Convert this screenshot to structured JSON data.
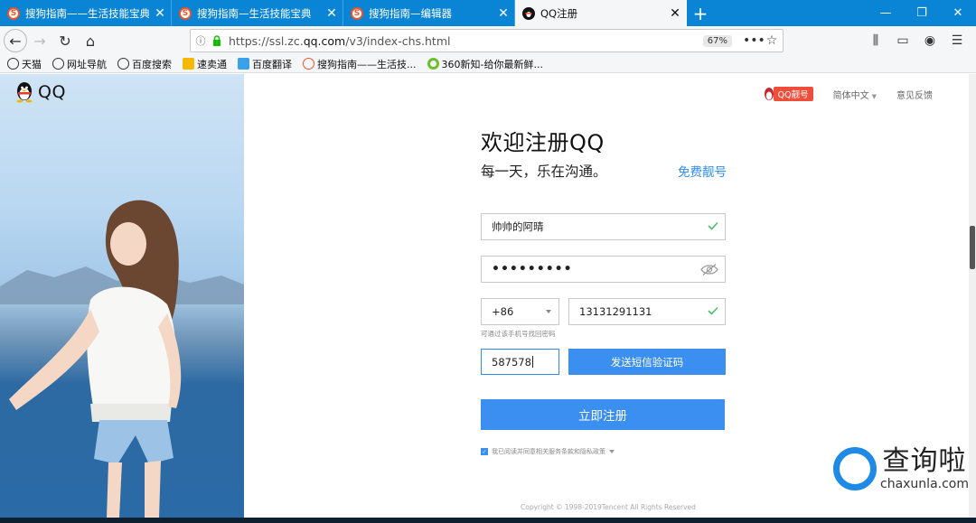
{
  "browser": {
    "tabs": [
      {
        "title": "搜狗指南——生活技能宝典",
        "icon": "sogou-icon",
        "active": false
      },
      {
        "title": "搜狗指南—生活技能宝典",
        "icon": "sogou-icon",
        "active": false
      },
      {
        "title": "搜狗指南—编辑器",
        "icon": "sogou-icon",
        "active": false
      },
      {
        "title": "QQ注册",
        "icon": "qq-penguin-icon",
        "active": true
      }
    ],
    "new_tab_glyph": "+",
    "url_prefix": "https://ssl.zc.",
    "url_host": "qq.com",
    "url_path": "/v3/index-chs.html",
    "zoom": "67%",
    "bookmarks": [
      {
        "label": "天猫",
        "icon": "globe-icon"
      },
      {
        "label": "网址导航",
        "icon": "globe-icon"
      },
      {
        "label": "百度搜索",
        "icon": "globe-icon"
      },
      {
        "label": "速卖通",
        "icon": "aliexpress-icon"
      },
      {
        "label": "百度翻译",
        "icon": "translate-icon"
      },
      {
        "label": "搜狗指南——生活技...",
        "icon": "sogou-icon"
      },
      {
        "label": "360新知-给你最新鲜...",
        "icon": "360-icon"
      }
    ]
  },
  "page": {
    "logo_text": "QQ",
    "header": {
      "liang_badge": "QQ靓号",
      "language": "简体中文",
      "feedback": "意见反馈"
    },
    "form": {
      "title": "欢迎注册QQ",
      "subtitle": "每一天，乐在沟通。",
      "free_number_link": "免费靓号",
      "nickname_value": "帅帅的阿晴",
      "password_mask": "•••••••••",
      "country_code": "+86",
      "phone_value": "13131291131",
      "phone_hint": "可通过该手机号找回密码",
      "sms_code_value": "587578",
      "send_sms_label": "发送短信验证码",
      "register_label": "立即注册",
      "agree_text": "我已阅读并同意相关服务条款和隐私政策"
    },
    "copyright": "Copyright © 1998-2019Tencent All Rights Reserved"
  },
  "watermark": {
    "cn": "查询啦",
    "en": "chaxunla.com"
  },
  "colors": {
    "tabbar": "#0a84d4",
    "accent": "#3b8ff0",
    "success": "#4cc067",
    "liang_red": "#f04d3b"
  }
}
